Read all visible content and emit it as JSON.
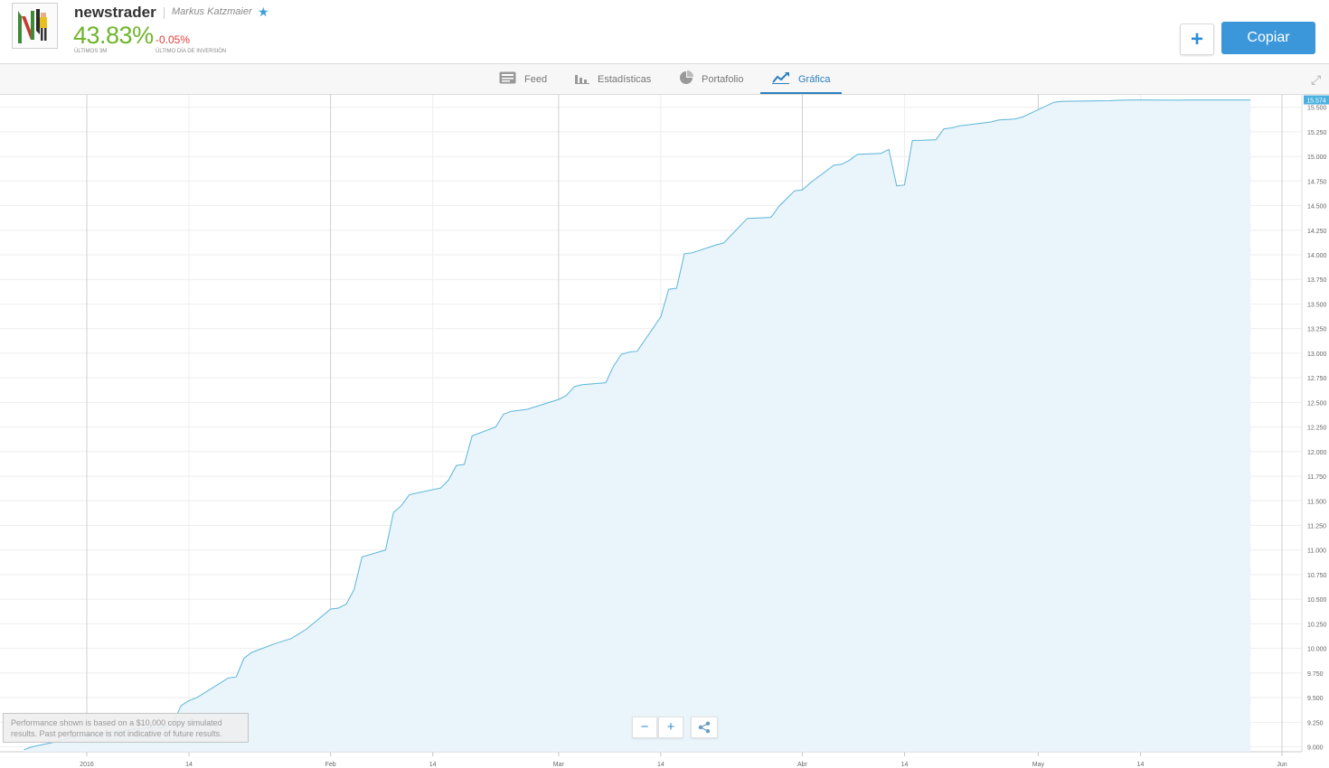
{
  "header": {
    "username": "newstrader",
    "full_name": "Markus Katzmaier",
    "gain": "43.83%",
    "gain_caption": "ÚLTIMOS 3M",
    "day_change": "-0.05%",
    "day_caption": "ÚLTIMO DÍA DE INVERSIÓN",
    "add_label": "+",
    "copy_label": "Copiar"
  },
  "tabs": [
    {
      "label": "Feed",
      "icon": "feed-icon"
    },
    {
      "label": "Estadísticas",
      "icon": "bar-chart-icon"
    },
    {
      "label": "Portafolio",
      "icon": "pie-chart-icon"
    },
    {
      "label": "Gráfica",
      "icon": "line-chart-icon",
      "active": true
    }
  ],
  "controls": {
    "zoom_out": "−",
    "zoom_in": "+"
  },
  "disclaimer": "Performance shown is based on a $10,000 copy simulated results. Past performance is not indicative of future results.",
  "colors": {
    "accent": "#3c97da",
    "gain": "#6fb52c",
    "loss": "#e0403c",
    "line": "#5bb6d9",
    "fill": "#eaf4fb"
  },
  "chart_data": {
    "type": "area",
    "current_value_label": "15.574",
    "ylim": [
      8950,
      15625
    ],
    "y_ticks": [
      "9.000",
      "9.250",
      "9.500",
      "9.750",
      "10.000",
      "10.250",
      "10.500",
      "10.750",
      "11.000",
      "11.250",
      "11.500",
      "11.750",
      "12.000",
      "12.250",
      "12.500",
      "12.750",
      "13.000",
      "13.250",
      "13.500",
      "13.750",
      "14.000",
      "14.250",
      "14.500",
      "14.750",
      "15.000",
      "15.250",
      "15.500"
    ],
    "x_ticks": [
      {
        "date": "2016-01-01",
        "label": "2016",
        "major": true
      },
      {
        "date": "2016-01-14",
        "label": "14",
        "major": false
      },
      {
        "date": "2016-02-01",
        "label": "Feb",
        "major": true
      },
      {
        "date": "2016-02-14",
        "label": "14",
        "major": false
      },
      {
        "date": "2016-03-01",
        "label": "Mar",
        "major": true
      },
      {
        "date": "2016-03-14",
        "label": "14",
        "major": false
      },
      {
        "date": "2016-04-01",
        "label": "Abr",
        "major": true
      },
      {
        "date": "2016-04-14",
        "label": "14",
        "major": false
      },
      {
        "date": "2016-05-01",
        "label": "May",
        "major": true
      },
      {
        "date": "2016-05-14",
        "label": "14",
        "major": false
      },
      {
        "date": "2016-06-01",
        "label": "Jun",
        "major": true
      }
    ],
    "x": [
      "2015-12-24",
      "2015-12-25",
      "2015-12-28",
      "2015-12-30",
      "2016-01-04",
      "2016-01-08",
      "2016-01-11",
      "2016-01-12",
      "2016-01-13",
      "2016-01-14",
      "2016-01-15",
      "2016-01-19",
      "2016-01-20",
      "2016-01-21",
      "2016-01-22",
      "2016-01-25",
      "2016-01-27",
      "2016-01-28",
      "2016-01-29",
      "2016-02-01",
      "2016-02-02",
      "2016-02-03",
      "2016-02-04",
      "2016-02-05",
      "2016-02-08",
      "2016-02-09",
      "2016-02-10",
      "2016-02-11",
      "2016-02-12",
      "2016-02-15",
      "2016-02-16",
      "2016-02-17",
      "2016-02-18",
      "2016-02-19",
      "2016-02-22",
      "2016-02-23",
      "2016-02-24",
      "2016-02-25",
      "2016-02-26",
      "2016-03-01",
      "2016-03-02",
      "2016-03-03",
      "2016-03-04",
      "2016-03-07",
      "2016-03-08",
      "2016-03-09",
      "2016-03-10",
      "2016-03-11",
      "2016-03-14",
      "2016-03-15",
      "2016-03-16",
      "2016-03-17",
      "2016-03-18",
      "2016-03-21",
      "2016-03-22",
      "2016-03-25",
      "2016-03-28",
      "2016-03-29",
      "2016-03-30",
      "2016-03-31",
      "2016-04-01",
      "2016-04-02",
      "2016-04-05",
      "2016-04-06",
      "2016-04-07",
      "2016-04-08",
      "2016-04-11",
      "2016-04-12",
      "2016-04-13",
      "2016-04-14",
      "2016-04-15",
      "2016-04-18",
      "2016-04-19",
      "2016-04-20",
      "2016-04-21",
      "2016-04-22",
      "2016-04-23",
      "2016-04-25",
      "2016-04-26",
      "2016-04-28",
      "2016-04-29",
      "2016-05-03",
      "2016-05-04",
      "2016-05-10",
      "2016-05-11",
      "2016-05-13",
      "2016-05-16",
      "2016-05-17",
      "2016-05-19",
      "2016-05-20",
      "2016-05-23",
      "2016-05-24",
      "2016-05-25",
      "2016-05-26",
      "2016-05-27",
      "2016-05-28"
    ],
    "y": [
      8970,
      9000,
      9050,
      9100,
      9150,
      9190,
      9200,
      9250,
      9420,
      9470,
      9500,
      9700,
      9710,
      9900,
      9960,
      10050,
      10100,
      10150,
      10200,
      10400,
      10410,
      10450,
      10600,
      10930,
      11000,
      11380,
      11450,
      11560,
      11580,
      11630,
      11710,
      11860,
      11870,
      12160,
      12250,
      12380,
      12410,
      12420,
      12430,
      12530,
      12570,
      12660,
      12680,
      12700,
      12870,
      12990,
      13010,
      13020,
      13370,
      13650,
      13660,
      14010,
      14020,
      14100,
      14120,
      14370,
      14380,
      14490,
      14570,
      14650,
      14660,
      14730,
      14910,
      14920,
      14960,
      15020,
      15030,
      15070,
      14700,
      14710,
      15160,
      15170,
      15280,
      15290,
      15310,
      15320,
      15330,
      15350,
      15370,
      15380,
      15400,
      15550,
      15560,
      15565,
      15570,
      15574,
      15573,
      15572,
      15571,
      15574,
      15574,
      15574,
      15574,
      15574,
      15574,
      15574
    ]
  }
}
